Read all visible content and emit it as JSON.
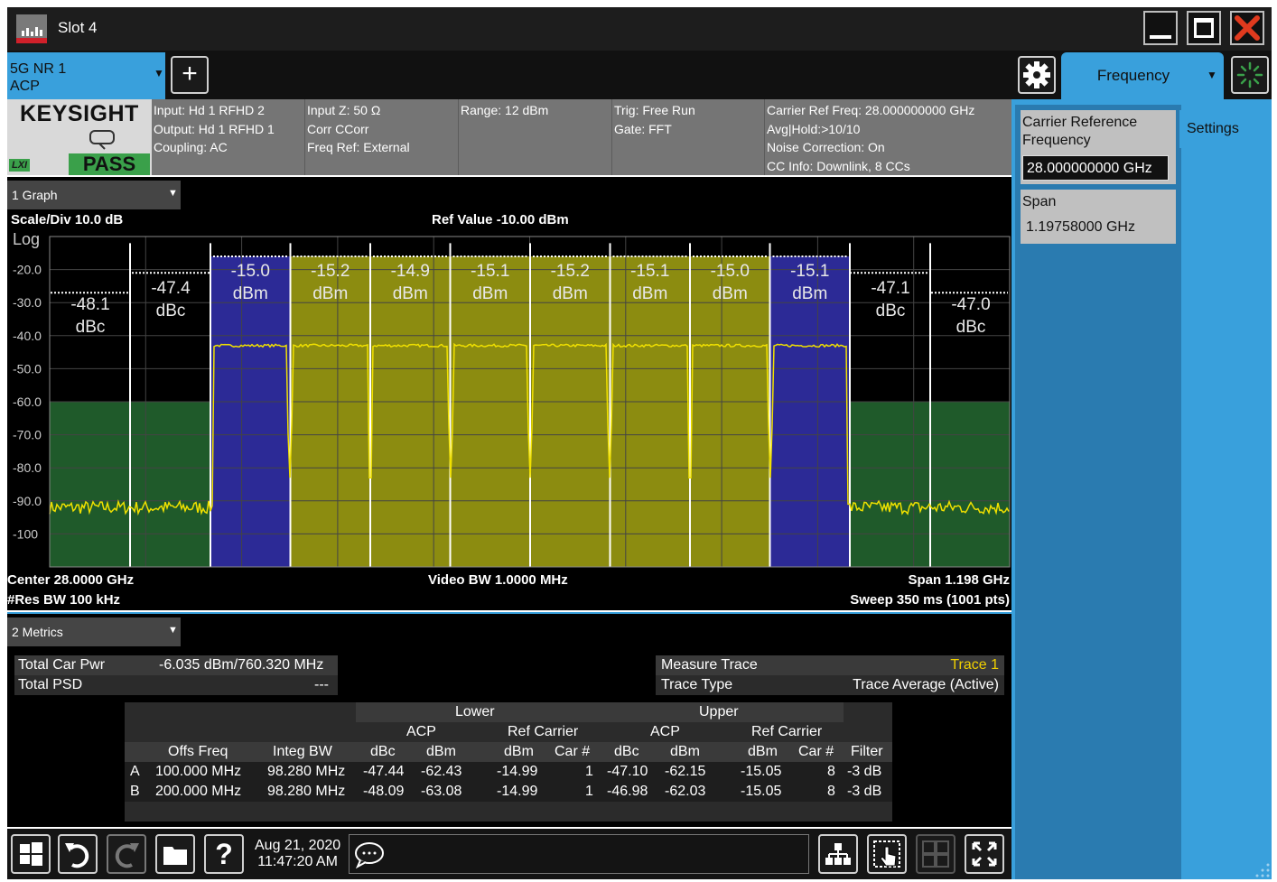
{
  "window": {
    "title": "Slot 4"
  },
  "tabs": {
    "measurement_line1": "5G NR 1",
    "measurement_line2": "ACP",
    "add_label": "+"
  },
  "menu_panel": {
    "active_menu": "Frequency",
    "settings_tab": "Settings",
    "carrier_ref_freq_label": "Carrier Reference Frequency",
    "carrier_ref_freq_value": "28.000000000 GHz",
    "span_label": "Span",
    "span_value": "1.19758000 GHz"
  },
  "info": {
    "brand": "KEYSIGHT",
    "lxi": "LXI",
    "status": "PASS",
    "col1": [
      "Input: Hd 1 RFHD 2",
      "Output: Hd 1 RFHD 1",
      "Coupling: AC"
    ],
    "col2": [
      "Input Z: 50 Ω",
      "Corr CCorr",
      "Freq Ref: External"
    ],
    "col3": [
      "Range: 12 dBm"
    ],
    "col4": [
      "Trig: Free Run",
      "Gate: FFT"
    ],
    "col5": [
      "Carrier Ref Freq: 28.000000000 GHz",
      "Avg|Hold:>10/10",
      "Noise Correction: On",
      "CC Info: Downlink, 8 CCs"
    ]
  },
  "graph": {
    "window_tab": "1 Graph",
    "scale_div": "Scale/Div 10.0 dB",
    "ref_value": "Ref Value -10.00 dBm",
    "log_label": "Log",
    "y_ticks": [
      "-20.0",
      "-30.0",
      "-40.0",
      "-50.0",
      "-60.0",
      "-70.0",
      "-80.0",
      "-90.0",
      "-100"
    ],
    "center": "Center 28.0000 GHz",
    "res_bw": "#Res BW 100 kHz",
    "video_bw": "Video BW 1.0000 MHz",
    "span": "Span 1.198 GHz",
    "sweep": "Sweep 350 ms (1001 pts)"
  },
  "chart_data": {
    "type": "line",
    "ylim": [
      -110,
      -10
    ],
    "y_scale_per_div": 10,
    "x_center_ghz": 28.0,
    "x_span_ghz": 1.198,
    "carriers": [
      {
        "value": "-15.0",
        "unit": "dBm",
        "color": "#2c2a96"
      },
      {
        "value": "-15.2",
        "unit": "dBm",
        "color": "#8c8c10"
      },
      {
        "value": "-14.9",
        "unit": "dBm",
        "color": "#8c8c10"
      },
      {
        "value": "-15.1",
        "unit": "dBm",
        "color": "#8c8c10"
      },
      {
        "value": "-15.2",
        "unit": "dBm",
        "color": "#8c8c10"
      },
      {
        "value": "-15.1",
        "unit": "dBm",
        "color": "#8c8c10"
      },
      {
        "value": "-15.0",
        "unit": "dBm",
        "color": "#8c8c10"
      },
      {
        "value": "-15.1",
        "unit": "dBm",
        "color": "#2c2a96"
      }
    ],
    "offsets": [
      {
        "value": "-48.1",
        "unit": "dBc",
        "side": "lower-B"
      },
      {
        "value": "-47.4",
        "unit": "dBc",
        "side": "lower-A"
      },
      {
        "value": "-47.1",
        "unit": "dBc",
        "side": "upper-A"
      },
      {
        "value": "-47.0",
        "unit": "dBc",
        "side": "upper-B"
      }
    ],
    "carrier_level_dbm": -43,
    "noise_floor_dbm": -92,
    "trace_color": "#f0e000"
  },
  "metrics": {
    "window_tab": "2 Metrics",
    "total_car_pwr_label": "Total Car Pwr",
    "total_car_pwr_value": "-6.035 dBm/760.320 MHz",
    "total_psd_label": "Total PSD",
    "total_psd_value": "---",
    "measure_trace_label": "Measure Trace",
    "measure_trace_value": "Trace 1",
    "trace_type_label": "Trace Type",
    "trace_type_value": "Trace Average (Active)",
    "table": {
      "lower": "Lower",
      "upper": "Upper",
      "acp": "ACP",
      "ref_carrier": "Ref Carrier",
      "headers": [
        "Offs Freq",
        "Integ BW",
        "dBc",
        "dBm",
        "dBm",
        "Car #",
        "dBc",
        "dBm",
        "dBm",
        "Car #",
        "Filter"
      ],
      "rows": [
        [
          "A",
          "100.000 MHz",
          "98.280 MHz",
          "-47.44",
          "-62.43",
          "-14.99",
          "1",
          "-47.10",
          "-62.15",
          "-15.05",
          "8",
          "-3 dB"
        ],
        [
          "B",
          "200.000 MHz",
          "98.280 MHz",
          "-48.09",
          "-63.08",
          "-14.99",
          "1",
          "-46.98",
          "-62.03",
          "-15.05",
          "8",
          "-3 dB"
        ]
      ]
    }
  },
  "taskbar": {
    "date": "Aug 21, 2020",
    "time": "11:47:20 AM",
    "help": "?"
  }
}
